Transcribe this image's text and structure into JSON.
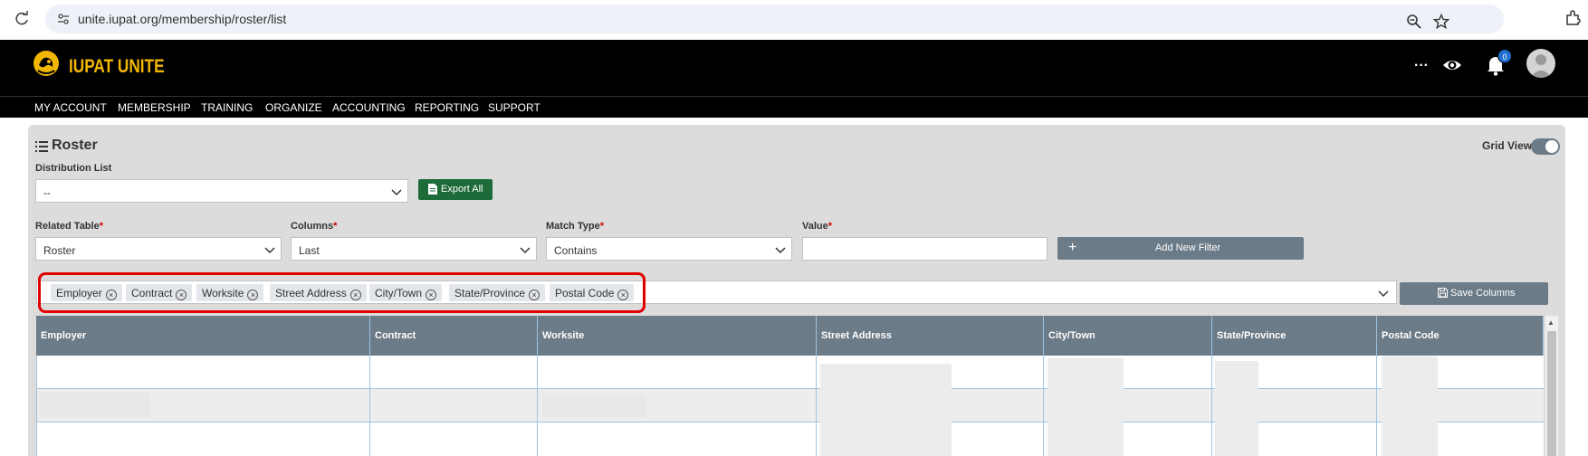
{
  "browser": {
    "url": "unite.iupat.org/membership/roster/list"
  },
  "header": {
    "logo_text": "IUPAT UNITE",
    "logo_sub": "IUPAT",
    "more_label": "···",
    "notification_count": "0"
  },
  "nav": {
    "items": [
      {
        "label": "MY ACCOUNT"
      },
      {
        "label": "MEMBERSHIP"
      },
      {
        "label": "TRAINING"
      },
      {
        "label": "ORGANIZE"
      },
      {
        "label": "ACCOUNTING"
      },
      {
        "label": "REPORTING"
      },
      {
        "label": "SUPPORT"
      }
    ]
  },
  "page": {
    "title": "Roster",
    "grid_view_label": "Grid View",
    "grid_view_on": true
  },
  "distribution": {
    "label": "Distribution List",
    "value": "--",
    "export_label": "Export All"
  },
  "filters": {
    "related_table": {
      "label": "Related Table",
      "value": "Roster"
    },
    "columns": {
      "label": "Columns",
      "value": "Last"
    },
    "match_type": {
      "label": "Match Type",
      "value": "Contains"
    },
    "value": {
      "label": "Value",
      "value": ""
    },
    "required_mark": "*",
    "add_label": "Add New Filter"
  },
  "selected_columns": [
    "Employer",
    "Contract",
    "Worksite",
    "Street Address",
    "City/Town",
    "State/Province",
    "Postal Code"
  ],
  "save_columns_label": "Save Columns",
  "table": {
    "headers": [
      "Employer",
      "Contract",
      "Worksite",
      "Street Address",
      "City/Town",
      "State/Province",
      "Postal Code"
    ]
  },
  "colors": {
    "brand": "#f2b705",
    "header_bg": "#000000",
    "export_green": "#1e6b3a",
    "slate": "#6b7b88",
    "highlight": "#e00000"
  }
}
